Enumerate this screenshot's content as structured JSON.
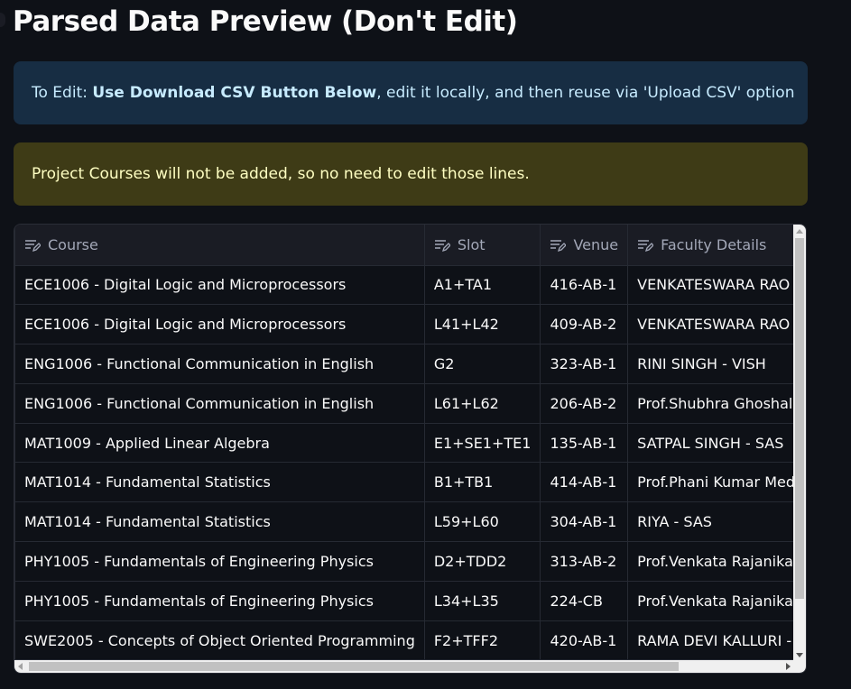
{
  "page": {
    "title": "Parsed Data Preview (Don't Edit)"
  },
  "info_alert": {
    "prefix": "To Edit: ",
    "bold": "Use Download CSV Button Below",
    "suffix": ", edit it locally, and then reuse via 'Upload CSV' option"
  },
  "warning_alert": {
    "text": "Project Courses will not be added, so no need to edit those lines."
  },
  "table": {
    "columns": [
      "Course",
      "Slot",
      "Venue",
      "Faculty Details"
    ],
    "header_icon": "edit-column-icon",
    "rows": [
      [
        "ECE1006 - Digital Logic and Microprocessors",
        "A1+TA1",
        "416-AB-1",
        "VENKATESWARA RAO BHUK"
      ],
      [
        "ECE1006 - Digital Logic and Microprocessors",
        "L41+L42",
        "409-AB-2",
        "VENKATESWARA RAO BHUK"
      ],
      [
        "ENG1006 - Functional Communication in English",
        "G2",
        "323-AB-1",
        "RINI SINGH - VISH"
      ],
      [
        "ENG1006 - Functional Communication in English",
        "L61+L62",
        "206-AB-2",
        "Prof.Shubhra Ghoshal - VIS"
      ],
      [
        "MAT1009 - Applied Linear Algebra",
        "E1+SE1+TE1",
        "135-AB-1",
        "SATPAL SINGH - SAS"
      ],
      [
        "MAT1014 - Fundamental Statistics",
        "B1+TB1",
        "414-AB-1",
        "Prof.Phani Kumar Meduri -"
      ],
      [
        "MAT1014 - Fundamental Statistics",
        "L59+L60",
        "304-AB-1",
        "RIYA - SAS"
      ],
      [
        "PHY1005 - Fundamentals of Engineering Physics",
        "D2+TDD2",
        "313-AB-2",
        "Prof.Venkata Rajanikanth M"
      ],
      [
        "PHY1005 - Fundamentals of Engineering Physics",
        "L34+L35",
        "224-CB",
        "Prof.Venkata Rajanikanth M"
      ],
      [
        "SWE2005 - Concepts of Object Oriented Programming",
        "F2+TFF2",
        "420-AB-1",
        "RAMA DEVI KALLURI - SCOF"
      ]
    ]
  },
  "colors": {
    "background": "#0e1117",
    "info_bg": "#172d43",
    "warning_bg": "#3e3b16"
  }
}
